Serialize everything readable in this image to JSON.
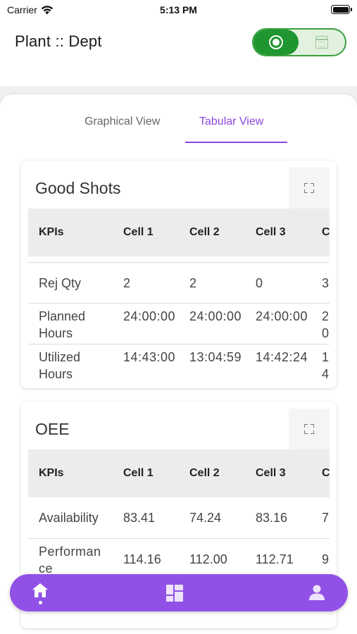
{
  "status_bar": {
    "carrier": "Carrier",
    "time": "5:13 PM"
  },
  "header": {
    "title": "Plant :: Dept"
  },
  "view_toggle": {
    "active": "radio-icon",
    "inactive": "calendar-icon",
    "accent": "#1f9630"
  },
  "tabs": [
    {
      "label": "Graphical View",
      "selected": false
    },
    {
      "label": "Tabular View",
      "selected": true
    }
  ],
  "cards": [
    {
      "title": "Good Shots",
      "columns": [
        "KPIs",
        "Cell 1",
        "Cell 2",
        "Cell 3",
        "C"
      ],
      "rows": [
        {
          "kpi": "Rej Qty",
          "cells": [
            "2",
            "2",
            "0",
            "3"
          ]
        },
        {
          "kpi": "Planned Hours",
          "cells": [
            "24:00:00",
            "24:00:00",
            "24:00:00",
            "20"
          ]
        },
        {
          "kpi": "Utilized Hours",
          "cells": [
            "14:43:00",
            "13:04:59",
            "14:42:24",
            "14"
          ]
        }
      ]
    },
    {
      "title": "OEE",
      "columns": [
        "KPIs",
        "Cell 1",
        "Cell 2",
        "Cell 3",
        "C"
      ],
      "rows": [
        {
          "kpi": "Availability",
          "cells": [
            "83.41",
            "74.24",
            "83.16",
            "7"
          ]
        },
        {
          "kpi": "Performance",
          "cells": [
            "114.16",
            "112.00",
            "112.71",
            "9"
          ]
        }
      ]
    }
  ],
  "bottom_nav": {
    "items": [
      "home-icon",
      "dashboard-icon",
      "profile-icon"
    ],
    "selected": "home-icon",
    "color": "#9151e6"
  },
  "colors": {
    "accent": "#8c47e0",
    "toggle_green": "#1f9630"
  }
}
